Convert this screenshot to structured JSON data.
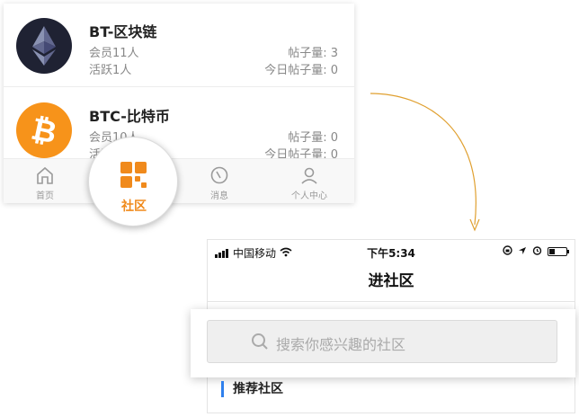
{
  "communities": [
    {
      "icon": "ethereum-icon",
      "title": "BT-区块链",
      "members": "会员11人",
      "active": "活跃1人",
      "posts": "帖子量: 3",
      "today_posts": "今日帖子量: 0"
    },
    {
      "icon": "bitcoin-icon",
      "title": "BTC-比特币",
      "members": "会员10人",
      "active": "活跃",
      "posts": "帖子量: 0",
      "today_posts": "今日帖子量: 0"
    }
  ],
  "tabbar": {
    "home": "首页",
    "community": "社区",
    "messages": "消息",
    "profile": "个人中心",
    "active_tab": "community"
  },
  "status_bar": {
    "carrier": "中国移动",
    "time": "下午5:34"
  },
  "community_page": {
    "title": "进社区",
    "search_placeholder": "搜索你感兴趣的社区",
    "section_title": "推荐社区"
  },
  "colors": {
    "accent_orange": "#f08a1c",
    "section_bar_blue": "#2f80ed",
    "ethereum_bg": "#1f2233",
    "bitcoin_bg": "#f7931a"
  }
}
